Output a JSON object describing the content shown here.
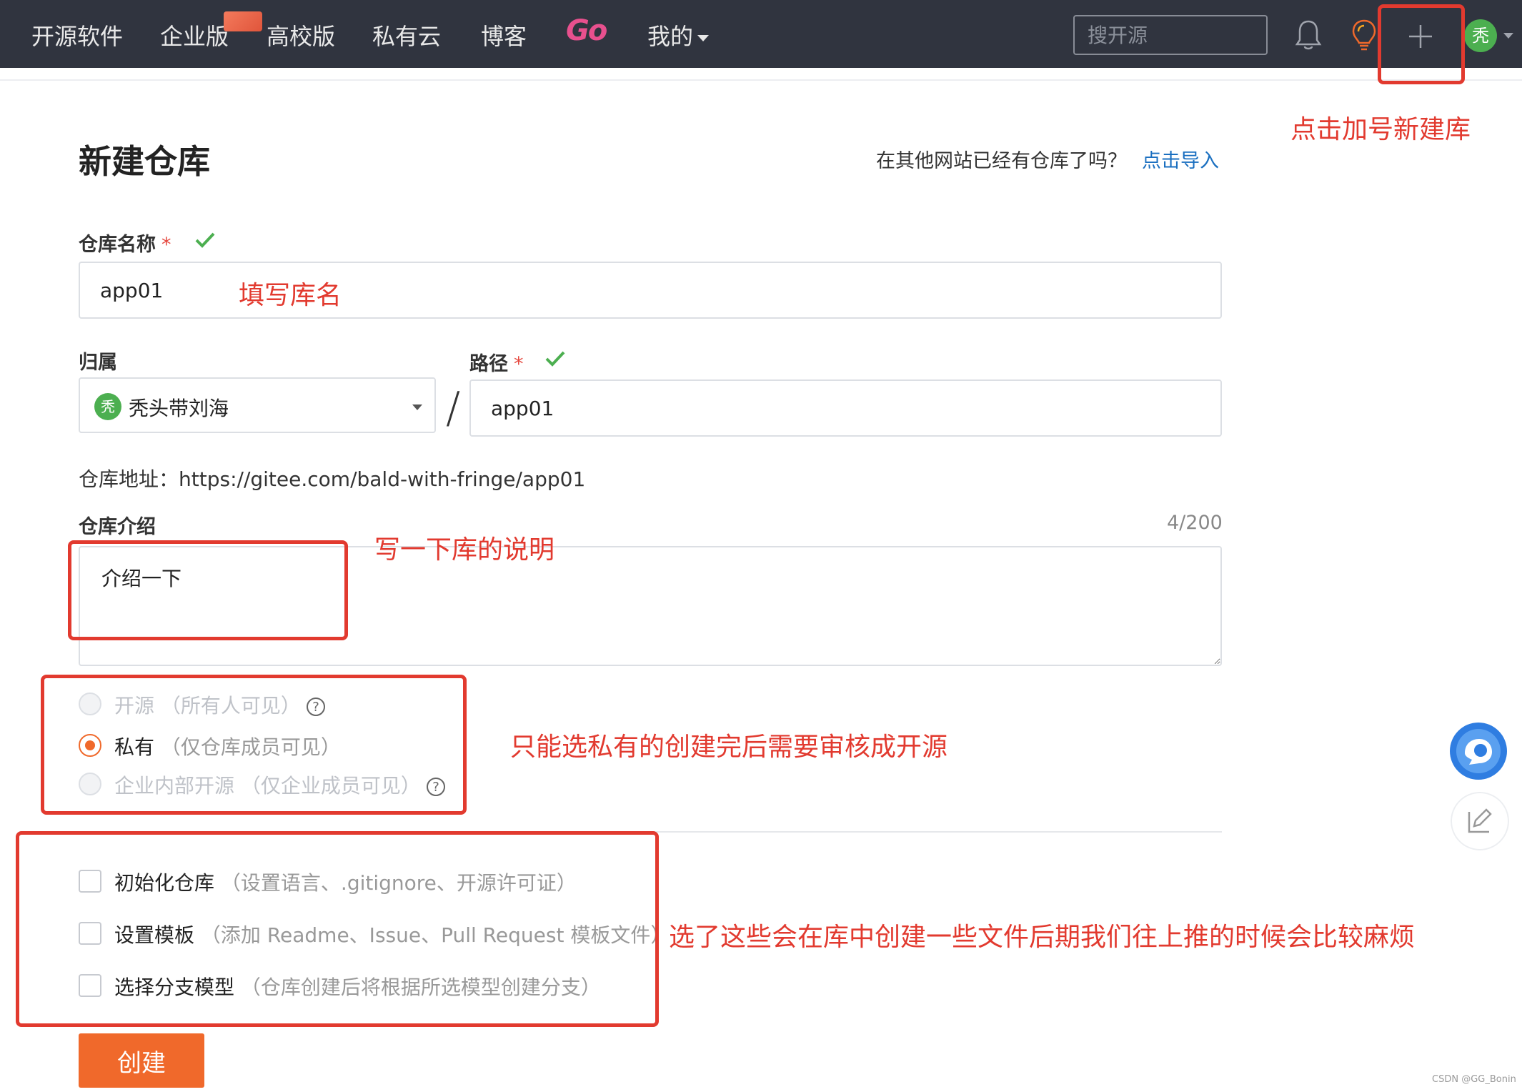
{
  "navbar": {
    "items": [
      "开源软件",
      "企业版",
      "高校版",
      "私有云",
      "博客",
      "Go",
      "我的"
    ],
    "search_placeholder": "搜开源",
    "avatar_initial": "秃"
  },
  "form": {
    "title": "新建仓库",
    "import_hint": "在其他网站已经有仓库了吗？",
    "import_link": "点击导入",
    "repo_name_label": "仓库名称",
    "required_mark": "*",
    "repo_name_value": "app01",
    "owner_label": "归属",
    "owner_initial": "秃",
    "owner_name": "秃头带刘海",
    "path_label": "路径",
    "path_separator": "/",
    "path_value": "app01",
    "address_label": "仓库地址：",
    "address_value": "https://gitee.com/bald-with-fringe/app01",
    "desc_label": "仓库介绍",
    "desc_counter": "4/200",
    "desc_value": "介绍一下",
    "visibility": [
      {
        "label": "开源",
        "note": "（所有人可见）",
        "checked": false,
        "disabled": true,
        "help": true
      },
      {
        "label": "私有",
        "note": "（仅仓库成员可见）",
        "checked": true,
        "disabled": false,
        "help": false
      },
      {
        "label": "企业内部开源",
        "note": "（仅企业成员可见）",
        "checked": false,
        "disabled": true,
        "help": true
      }
    ],
    "options": [
      {
        "label": "初始化仓库",
        "note": "（设置语言、.gitignore、开源许可证）"
      },
      {
        "label": "设置模板",
        "note": "（添加 Readme、Issue、Pull Request 模板文件）"
      },
      {
        "label": "选择分支模型",
        "note": "（仓库创建后将根据所选模型创建分支）"
      }
    ],
    "create_button": "创建"
  },
  "annotations": {
    "plus": "点击加号新建库",
    "repo_name": "填写库名",
    "description": "写一下库的说明",
    "visibility": "只能选私有的创建完后需要审核成开源",
    "options": "选了这些会在库中创建一些文件后期我们往上推的时候会比较麻烦"
  },
  "watermark": "CSDN @GG_Bonin",
  "colors": {
    "navbar_bg": "#30343f",
    "accent_orange": "#f0692b",
    "annotation_red": "#e23a2f",
    "link_blue": "#1a6fc0",
    "success_green": "#4caf50"
  }
}
